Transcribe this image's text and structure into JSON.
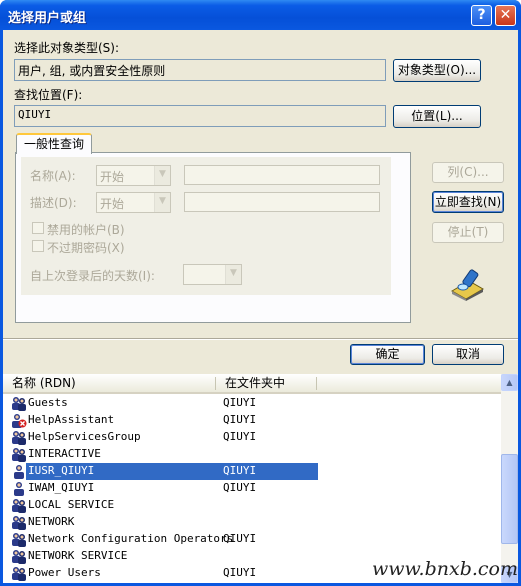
{
  "window": {
    "title": "选择用户或组",
    "help_glyph": "?",
    "close_glyph": "✕"
  },
  "object_type": {
    "label": "选择此对象类型(S):",
    "value": "用户, 组, 或内置安全性原则",
    "button": "对象类型(O)..."
  },
  "location": {
    "label": "查找位置(F):",
    "value": "QIUYI",
    "button": "位置(L)..."
  },
  "query": {
    "tab_label": "一般性查询",
    "name_label": "名称(A):",
    "name_option": "开始",
    "desc_label": "描述(D):",
    "desc_option": "开始",
    "disabled_accounts": "禁用的帐户(B)",
    "non_expiring": "不过期密码(X)",
    "days_label": "自上次登录后的天数(I):"
  },
  "side_buttons": {
    "columns": "列(C)...",
    "find_now": "立即查找(N)",
    "stop": "停止(T)"
  },
  "dialog_buttons": {
    "ok": "确定",
    "cancel": "取消"
  },
  "results": {
    "columns": [
      "名称 (RDN)",
      "在文件夹中"
    ],
    "rows": [
      {
        "name": "Guests",
        "folder": "QIUYI",
        "icon": "group-icon"
      },
      {
        "name": "HelpAssistant",
        "folder": "QIUYI",
        "icon": "disabled-user-icon"
      },
      {
        "name": "HelpServicesGroup",
        "folder": "QIUYI",
        "icon": "group-icon"
      },
      {
        "name": "INTERACTIVE",
        "folder": "",
        "icon": "group-icon"
      },
      {
        "name": "IUSR_QIUYI",
        "folder": "QIUYI",
        "icon": "user-icon",
        "selected": true
      },
      {
        "name": "IWAM_QIUYI",
        "folder": "QIUYI",
        "icon": "user-icon"
      },
      {
        "name": "LOCAL SERVICE",
        "folder": "",
        "icon": "group-icon"
      },
      {
        "name": "NETWORK",
        "folder": "",
        "icon": "group-icon"
      },
      {
        "name": "Network Configuration Operators",
        "folder": "QIUYI",
        "icon": "group-icon"
      },
      {
        "name": "NETWORK SERVICE",
        "folder": "",
        "icon": "group-icon"
      },
      {
        "name": "Power Users",
        "folder": "QIUYI",
        "icon": "group-icon"
      }
    ]
  },
  "watermark": "www.bnxb.com",
  "colors": {
    "titlebar": "#0a58e0",
    "selection": "#316ac5",
    "face": "#ece9d8"
  }
}
